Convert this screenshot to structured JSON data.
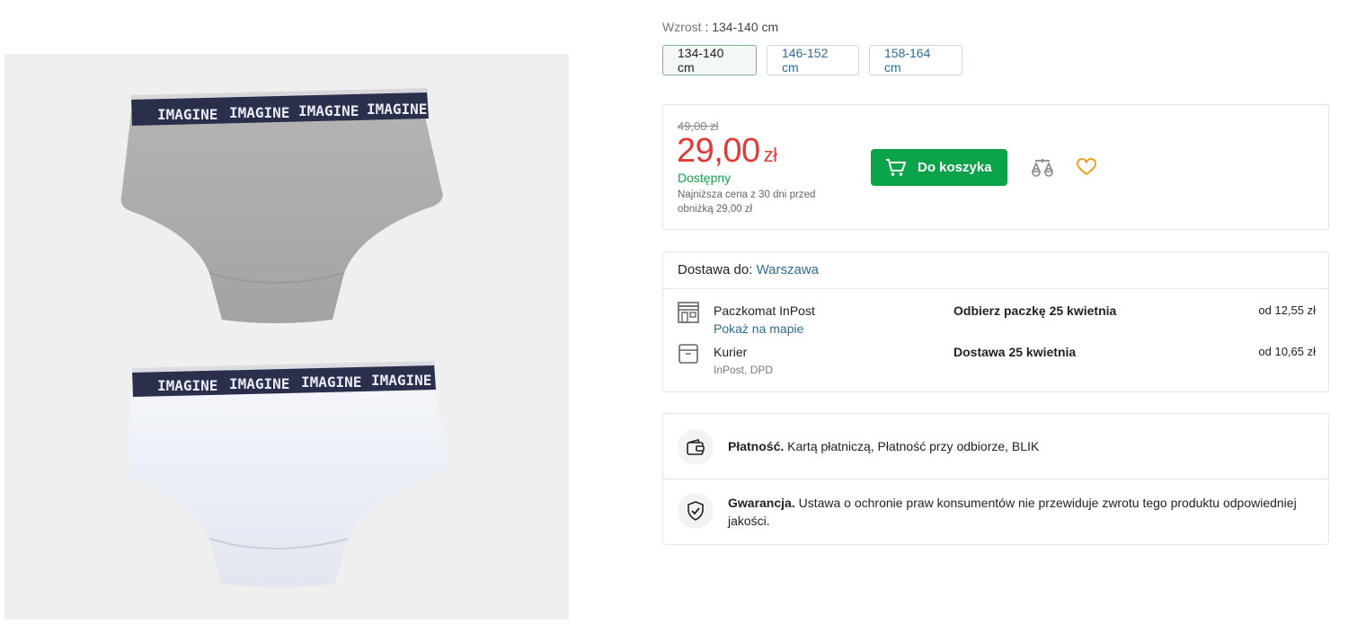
{
  "product_image": {
    "alt": "product-photo",
    "waistband_text": "IMAGINE"
  },
  "size_selector": {
    "label": "Wzrost",
    "selected_value": "134-140 cm",
    "options": [
      "134-140 cm",
      "146-152 cm",
      "158-164 cm"
    ]
  },
  "pricing": {
    "old_price": "49,00 zł",
    "price_value": "29,00",
    "price_currency": "zł",
    "availability": "Dostępny",
    "lowest_price_note": "Najniższa cena z 30 dni przed obniżką 29,00 zł",
    "add_to_cart_label": "Do koszyka"
  },
  "delivery": {
    "heading_prefix": "Dostawa do:",
    "city": "Warszawa",
    "options": [
      {
        "name": "Paczkomat InPost",
        "sub": "Pokaż na mapie",
        "when": "Odbierz paczkę 25 kwietnia",
        "cost": "od 12,55 zł",
        "icon": "parcel-locker-icon"
      },
      {
        "name": "Kurier",
        "sub": "InPost, DPD",
        "when": "Dostawa 25 kwietnia",
        "cost": "od 10,65 zł",
        "icon": "courier-box-icon"
      }
    ]
  },
  "info": {
    "payment_title": "Płatność.",
    "payment_text": "Kartą płatniczą, Płatność przy odbiorze, BLIK",
    "warranty_title": "Gwarancja.",
    "warranty_text": "Ustawa o ochronie praw konsumentów nie przewiduje zwrotu tego produktu odpowiedniej jakości."
  },
  "colors": {
    "accent_green": "#0ba34a",
    "price_red": "#e23a3a",
    "link_blue": "#2f6d8f",
    "heart_orange": "#f0a020"
  }
}
